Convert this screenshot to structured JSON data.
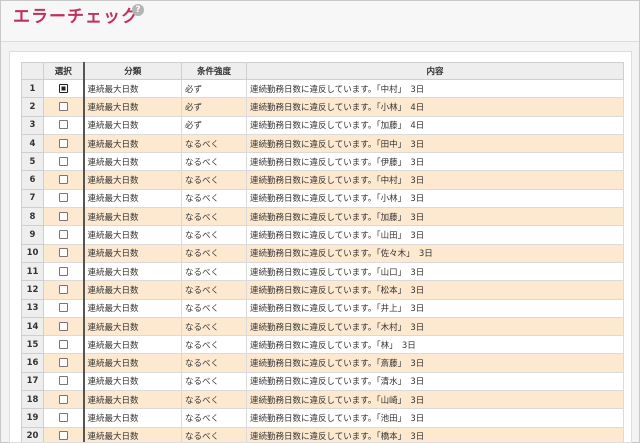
{
  "header": {
    "title": "エラーチェック",
    "help_glyph": "?"
  },
  "table": {
    "columns": [
      "選択",
      "分類",
      "条件強度",
      "内容"
    ],
    "rows": [
      {
        "num": "1",
        "category": "連続最大日数",
        "strength": "必ず",
        "content": "連続勤務日数に違反しています。「中村」　3日",
        "focused": true
      },
      {
        "num": "2",
        "category": "連続最大日数",
        "strength": "必ず",
        "content": "連続勤務日数に違反しています。「小林」　4日"
      },
      {
        "num": "3",
        "category": "連続最大日数",
        "strength": "必ず",
        "content": "連続勤務日数に違反しています。「加藤」　4日"
      },
      {
        "num": "4",
        "category": "連続最大日数",
        "strength": "なるべく",
        "content": "連続勤務日数に違反しています。「田中」　3日"
      },
      {
        "num": "5",
        "category": "連続最大日数",
        "strength": "なるべく",
        "content": "連続勤務日数に違反しています。「伊藤」　3日"
      },
      {
        "num": "6",
        "category": "連続最大日数",
        "strength": "なるべく",
        "content": "連続勤務日数に違反しています。「中村」　3日"
      },
      {
        "num": "7",
        "category": "連続最大日数",
        "strength": "なるべく",
        "content": "連続勤務日数に違反しています。「小林」　3日"
      },
      {
        "num": "8",
        "category": "連続最大日数",
        "strength": "なるべく",
        "content": "連続勤務日数に違反しています。「加藤」　3日"
      },
      {
        "num": "9",
        "category": "連続最大日数",
        "strength": "なるべく",
        "content": "連続勤務日数に違反しています。「山田」　3日"
      },
      {
        "num": "10",
        "category": "連続最大日数",
        "strength": "なるべく",
        "content": "連続勤務日数に違反しています。「佐々木」　3日"
      },
      {
        "num": "11",
        "category": "連続最大日数",
        "strength": "なるべく",
        "content": "連続勤務日数に違反しています。「山口」　3日"
      },
      {
        "num": "12",
        "category": "連続最大日数",
        "strength": "なるべく",
        "content": "連続勤務日数に違反しています。「松本」　3日"
      },
      {
        "num": "13",
        "category": "連続最大日数",
        "strength": "なるべく",
        "content": "連続勤務日数に違反しています。「井上」　3日"
      },
      {
        "num": "14",
        "category": "連続最大日数",
        "strength": "なるべく",
        "content": "連続勤務日数に違反しています。「木村」　3日"
      },
      {
        "num": "15",
        "category": "連続最大日数",
        "strength": "なるべく",
        "content": "連続勤務日数に違反しています。「林」　3日"
      },
      {
        "num": "16",
        "category": "連続最大日数",
        "strength": "なるべく",
        "content": "連続勤務日数に違反しています。「斎藤」　3日"
      },
      {
        "num": "17",
        "category": "連続最大日数",
        "strength": "なるべく",
        "content": "連続勤務日数に違反しています。「清水」　3日"
      },
      {
        "num": "18",
        "category": "連続最大日数",
        "strength": "なるべく",
        "content": "連続勤務日数に違反しています。「山崎」　3日"
      },
      {
        "num": "19",
        "category": "連続最大日数",
        "strength": "なるべく",
        "content": "連続勤務日数に違反しています。「池田」　3日"
      },
      {
        "num": "20",
        "category": "連続最大日数",
        "strength": "なるべく",
        "content": "連続勤務日数に違反しています。「橋本」　3日"
      }
    ]
  }
}
